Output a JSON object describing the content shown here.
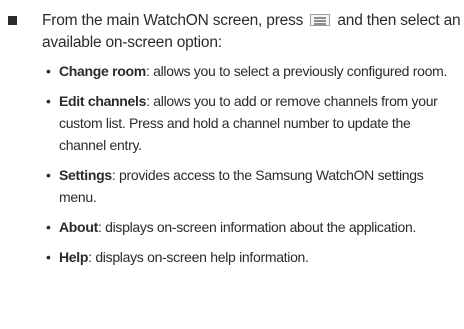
{
  "main": {
    "text_before_icon": "From the main WatchON screen, press",
    "icon": "menu-icon",
    "text_after_icon": "and then select an available on-screen option:"
  },
  "options": [
    {
      "term": "Change room",
      "desc": ": allows you to select a previously configured room."
    },
    {
      "term": "Edit channels",
      "desc": ": allows you to add or remove channels from your custom list. Press and hold a channel number to update the channel entry."
    },
    {
      "term": "Settings",
      "desc": ": provides access to the Samsung WatchON settings menu."
    },
    {
      "term": "About",
      "desc": ": displays on-screen information about the application."
    },
    {
      "term": "Help",
      "desc": ": displays on-screen help information."
    }
  ],
  "bullet_glyph": "•"
}
